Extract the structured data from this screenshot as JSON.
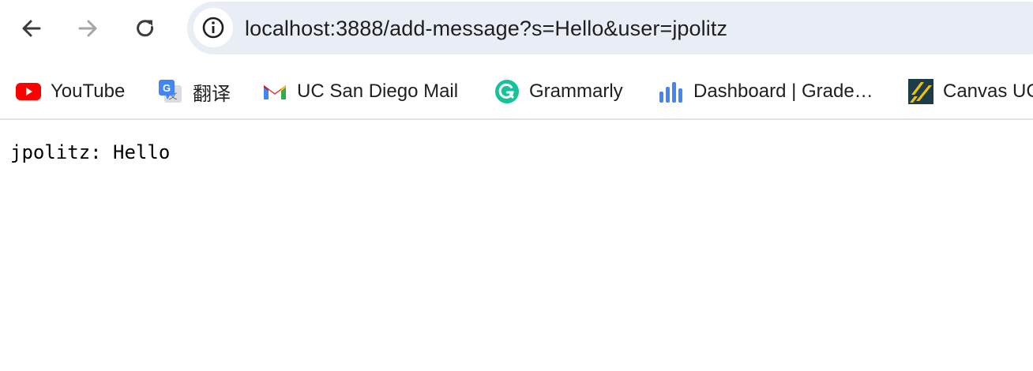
{
  "browser": {
    "nav": {
      "back_icon": "arrow-left-icon",
      "forward_icon": "arrow-right-icon",
      "reload_icon": "reload-icon"
    },
    "address_bar": {
      "site_info_icon": "info-icon",
      "url": "localhost:3888/add-message?s=Hello&user=jpolitz"
    },
    "bookmarks": [
      {
        "label": "YouTube",
        "icon": "youtube-icon"
      },
      {
        "label": "翻译",
        "icon": "google-translate-icon"
      },
      {
        "label": "UC San Diego Mail",
        "icon": "gmail-icon"
      },
      {
        "label": "Grammarly",
        "icon": "grammarly-icon"
      },
      {
        "label": "Dashboard | Grade…",
        "icon": "gradescope-icon"
      },
      {
        "label": "Canvas UC",
        "icon": "canvas-icon"
      }
    ]
  },
  "page": {
    "message": "jpolitz: Hello"
  },
  "colors": {
    "omnibox_bg": "#e9edf6",
    "youtube_red": "#ff0000",
    "grammarly_green": "#15c39a",
    "gradescope_blue": "#4285f4",
    "canvas_dark": "#1d3c4a",
    "canvas_yellow": "#f5c200"
  }
}
